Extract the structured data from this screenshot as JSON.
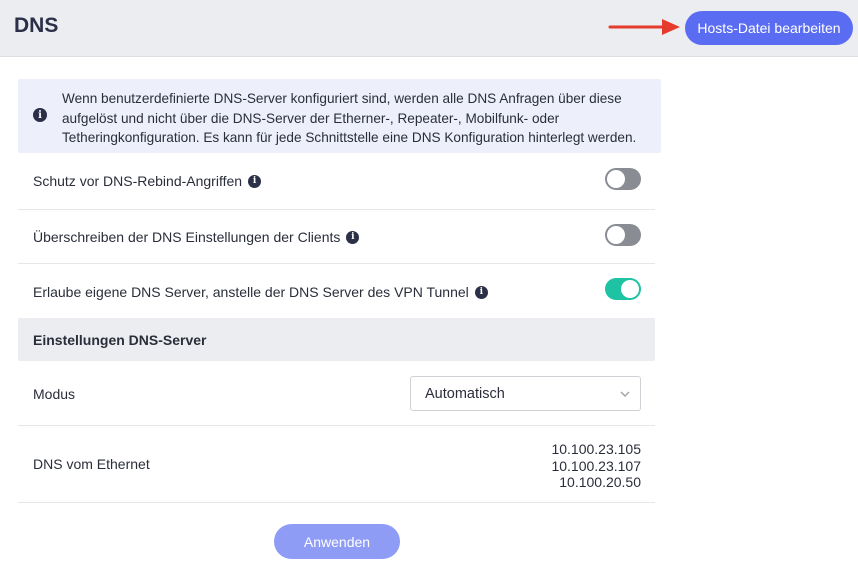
{
  "header": {
    "title": "DNS",
    "hosts_button": "Hosts-Datei bearbeiten"
  },
  "info": {
    "icon": "info-circle-icon",
    "text": "Wenn benutzerdefinierte DNS-Server konfiguriert sind, werden alle DNS Anfragen über diese aufgelöst und nicht über die DNS-Server der Etherner-, Repeater-, Mobilfunk- oder Tetheringkonfiguration. Es kann für jede Schnittstelle eine DNS Konfiguration hinterlegt werden."
  },
  "settings": [
    {
      "label": "Schutz vor DNS-Rebind-Angriffen",
      "enabled": false
    },
    {
      "label": "Überschreiben der DNS Einstellungen der Clients",
      "enabled": false
    },
    {
      "label": "Erlaube eigene DNS Server, anstelle der DNS Server des VPN Tunnel",
      "enabled": true
    }
  ],
  "dns_server_section": {
    "title": "Einstellungen DNS-Server",
    "mode_label": "Modus",
    "mode_value": "Automatisch",
    "dns_label": "DNS vom Ethernet",
    "dns_values": [
      "10.100.23.105",
      "10.100.23.107",
      "10.100.20.50"
    ]
  },
  "apply_button": "Anwenden",
  "colors": {
    "primary": "#5a6df2",
    "primary_disabled": "#8f9cf6",
    "toggle_on": "#1ec3a4",
    "toggle_off": "#8a8c93",
    "arrow": "#e53b2c"
  }
}
